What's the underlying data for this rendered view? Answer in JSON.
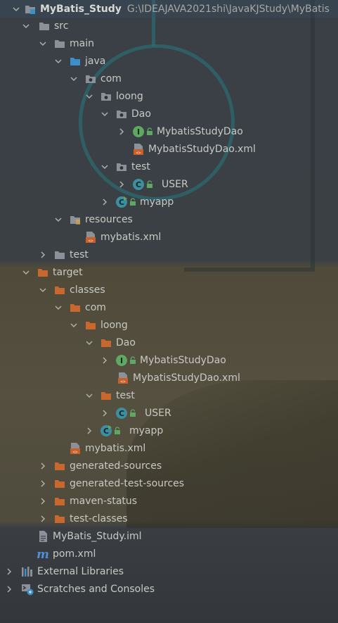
{
  "project": {
    "name": "MyBatis_Study",
    "path": "G:\\IDEAJAVA2021shi\\JavaKJStudy\\MyBatis"
  },
  "tree": {
    "src": "src",
    "main": "main",
    "java": "java",
    "com": "com",
    "loong": "loong",
    "dao": "Dao",
    "dao_interface": "MybatisStudyDao",
    "dao_xml": "MybatisStudyDao.xml",
    "test_pkg": "test",
    "user_class": "USER",
    "myapp_class": "myapp",
    "resources": "resources",
    "mybatis_xml": "mybatis.xml",
    "src_test": "test",
    "target": "target",
    "classes": "classes",
    "t_com": "com",
    "t_loong": "loong",
    "t_dao": "Dao",
    "t_dao_interface": "MybatisStudyDao",
    "t_dao_xml": "MybatisStudyDao.xml",
    "t_test_pkg": "test",
    "t_user_class": "USER",
    "t_myapp_class": "myapp",
    "t_mybatis_xml": "mybatis.xml",
    "generated_sources": "generated-sources",
    "generated_test_sources": "generated-test-sources",
    "maven_status": "maven-status",
    "test_classes": "test-classes",
    "iml": "MyBatis_Study.iml",
    "pom": "pom.xml",
    "external_libraries": "External Libraries",
    "scratches": "Scratches and Consoles"
  },
  "colors": {
    "folder_grey": "#8c9199",
    "folder_blue": "#3d8fc9",
    "folder_orange": "#c8682e",
    "interface_green": "#5fa862",
    "class_teal": "#3d8fa0",
    "xml_orange": "#c9602a"
  }
}
